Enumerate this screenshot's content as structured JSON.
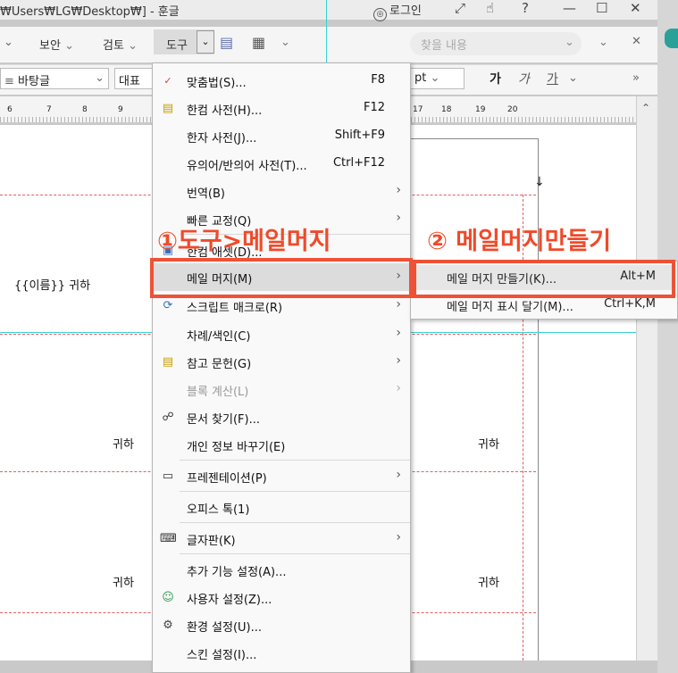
{
  "titlebar": {
    "path": "₩Users₩LG₩Desktop₩] - 훈글",
    "login_icon": "user-circle-icon",
    "login": "로그인",
    "icons": [
      "resize-icon",
      "hand-icon",
      "help-icon",
      "minimize-icon",
      "maximize-icon",
      "close-icon"
    ]
  },
  "menubar": {
    "items": [
      "보안",
      "검토",
      "도구"
    ],
    "search_placeholder": "찾을 내용"
  },
  "formatbar": {
    "style": "바탕글",
    "font": "대표",
    "unit": "pt",
    "bold": "가",
    "italic": "가",
    "underline": "가"
  },
  "ruler": {
    "ticks": [
      "6",
      "7",
      "8",
      "9",
      "17",
      "18",
      "19",
      "20"
    ]
  },
  "document": {
    "cells": [
      "{{이름}} 귀하",
      "귀하",
      "귀하",
      "귀하",
      "귀하"
    ]
  },
  "tools_menu": [
    {
      "label": "맞춤법(S)...",
      "shortcut": "F8",
      "icon": "spellcheck-icon"
    },
    {
      "label": "한컴 사전(H)...",
      "shortcut": "F12",
      "icon": "dictionary-icon"
    },
    {
      "label": "한자 사전(J)...",
      "shortcut": "Shift+F9",
      "icon": ""
    },
    {
      "label": "유의어/반의어 사전(T)...",
      "shortcut": "Ctrl+F12",
      "icon": ""
    },
    {
      "label": "번역(B)",
      "icon": ""
    },
    {
      "label": "빠른 교정(Q)",
      "icon": ""
    },
    {
      "label": "한컴 애셋(D)...",
      "icon": "asset-icon"
    },
    {
      "label": "메일 머지(M)",
      "icon": ""
    },
    {
      "label": "스크립트 매크로(R)",
      "icon": "macro-icon"
    },
    {
      "label": "차례/색인(C)",
      "icon": ""
    },
    {
      "label": "참고 문헌(G)",
      "icon": "reference-icon"
    },
    {
      "label": "블록 계산(L)",
      "icon": ""
    },
    {
      "label": "문서 찾기(F)...",
      "icon": "binoculars-icon"
    },
    {
      "label": "개인 정보 바꾸기(E)",
      "icon": ""
    },
    {
      "label": "프레젠테이션(P)",
      "icon": "presentation-icon"
    },
    {
      "label": "오피스 톡(1)",
      "icon": ""
    },
    {
      "label": "글자판(K)",
      "icon": "keyboard-icon"
    },
    {
      "label": "추가 기능 설정(A)...",
      "icon": ""
    },
    {
      "label": "사용자 설정(Z)...",
      "icon": "user-settings-icon"
    },
    {
      "label": "환경 설정(U)...",
      "icon": "gear-icon"
    },
    {
      "label": "스킨 설정(I)...",
      "icon": ""
    }
  ],
  "mail_merge_submenu": [
    {
      "label": "메일 머지 만들기(K)...",
      "shortcut": "Alt+M"
    },
    {
      "label": "메일 머지 표시 달기(M)...",
      "shortcut": "Ctrl+K,M"
    }
  ],
  "annotations": {
    "step1": "①도구>메일머지",
    "step2": "② 메일머지만들기",
    "color": "#ee5236"
  }
}
